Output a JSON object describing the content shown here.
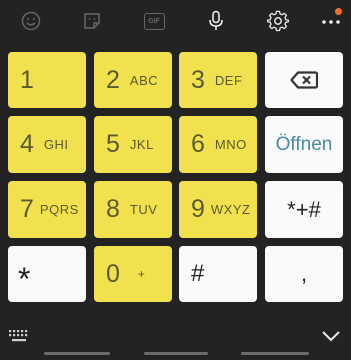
{
  "toolbar": {
    "icons": [
      "emoji-icon",
      "sticker-icon",
      "gif-icon",
      "microphone-icon",
      "settings-icon",
      "more-options-icon"
    ],
    "gif_label": "GIF",
    "notification_color": "#ff6d2a"
  },
  "keys": {
    "k1": {
      "num": "1",
      "letters": ""
    },
    "k2": {
      "num": "2",
      "letters": "ABC"
    },
    "k3": {
      "num": "3",
      "letters": "DEF"
    },
    "k4": {
      "num": "4",
      "letters": "GHI"
    },
    "k5": {
      "num": "5",
      "letters": "JKL"
    },
    "k6": {
      "num": "6",
      "letters": "MNO"
    },
    "k7": {
      "num": "7",
      "letters": "PQRS"
    },
    "k8": {
      "num": "8",
      "letters": "TUV"
    },
    "k9": {
      "num": "9",
      "letters": "WXYZ"
    },
    "k0": {
      "num": "0",
      "letters": "+"
    },
    "star": "*",
    "hash": "#",
    "comma": ",",
    "symbols": "*+#",
    "open": "Öffnen"
  },
  "colors": {
    "key_yellow": "#f2e14f",
    "key_white": "#fafafa",
    "background": "#232323",
    "open_text": "#4a8aa0"
  }
}
